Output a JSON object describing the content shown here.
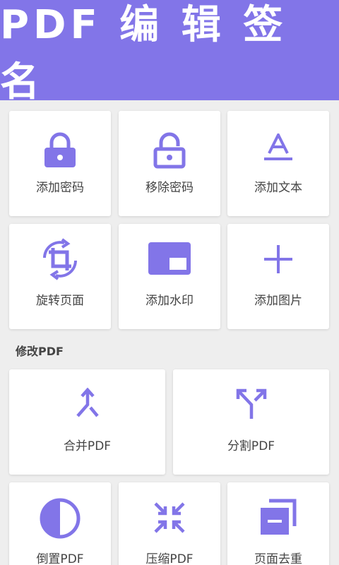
{
  "header": {
    "title": "PDF 编 辑 签 名"
  },
  "accent_color": "#8275e8",
  "grid_top": [
    {
      "label": "添加密码",
      "icon": "lock-icon"
    },
    {
      "label": "移除密码",
      "icon": "unlock-icon"
    },
    {
      "label": "添加文本",
      "icon": "text-icon"
    },
    {
      "label": "旋转页面",
      "icon": "rotate-crop-icon"
    },
    {
      "label": "添加水印",
      "icon": "watermark-icon"
    },
    {
      "label": "添加图片",
      "icon": "plus-icon"
    }
  ],
  "section": {
    "title": "修改PDF"
  },
  "modify": [
    {
      "label": "合并PDF",
      "icon": "merge-icon"
    },
    {
      "label": "分割PDF",
      "icon": "split-icon"
    },
    {
      "label": "倒置PDF",
      "icon": "invert-icon"
    },
    {
      "label": "压缩PDF",
      "icon": "compress-icon"
    },
    {
      "label": "页面去重",
      "icon": "duplicate-pages-icon"
    }
  ]
}
